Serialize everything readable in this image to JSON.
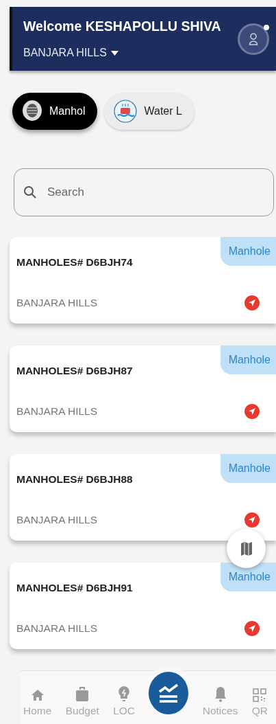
{
  "header": {
    "title": "Welcome KESHAPOLLU SHIVA",
    "location": "BANJARA HILLS",
    "notification_dot": true
  },
  "chips": [
    {
      "label": "Manhol",
      "selected": true,
      "kind": "manhole"
    },
    {
      "label": "Water L",
      "selected": false,
      "kind": "water"
    }
  ],
  "search": {
    "placeholder": "Search"
  },
  "records": [
    {
      "title": "MANHOLES# D6BJH74",
      "location": "BANJARA HILLS",
      "tag": "Manhole"
    },
    {
      "title": "MANHOLES# D6BJH87",
      "location": "BANJARA HILLS",
      "tag": "Manhole"
    },
    {
      "title": "MANHOLES# D6BJH88",
      "location": "BANJARA HILLS",
      "tag": "Manhole"
    },
    {
      "title": "MANHOLES# D6BJH91",
      "location": "BANJARA HILLS",
      "tag": "Manhole"
    }
  ],
  "nav": [
    {
      "label": "Home",
      "kind": "home"
    },
    {
      "label": "Budget",
      "kind": "budget"
    },
    {
      "label": "LOC",
      "kind": "loc"
    },
    {
      "kind": "center"
    },
    {
      "label": "Notices",
      "kind": "notices"
    },
    {
      "label": "QR",
      "kind": "qr"
    }
  ]
}
